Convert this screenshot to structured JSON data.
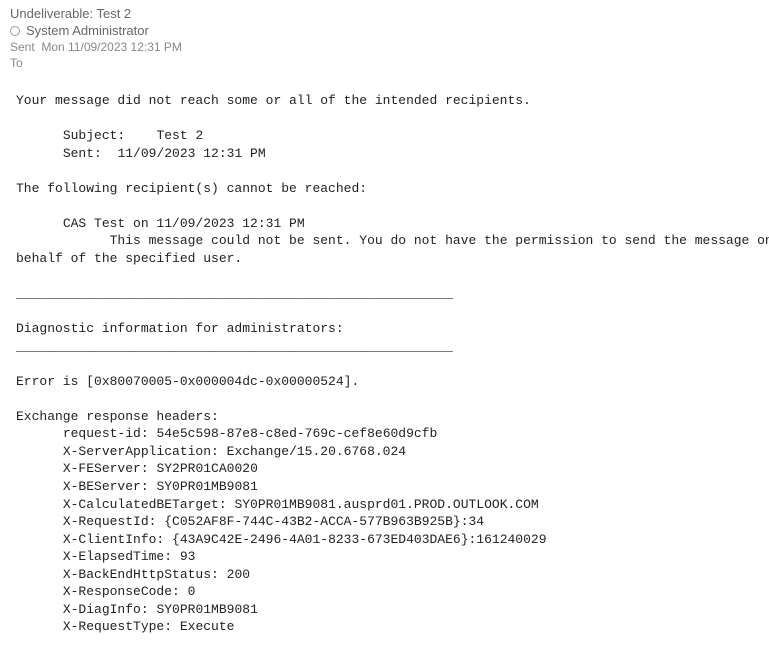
{
  "header": {
    "subject_line": "Undeliverable: Test 2",
    "from_name": "System Administrator",
    "sent_label": "Sent",
    "sent_value": "Mon 11/09/2023 12:31 PM",
    "to_label": "To"
  },
  "body": {
    "intro": "Your message did not reach some or all of the intended recipients.",
    "subject_label": "Subject:",
    "subject_value": "Test 2",
    "sent_label": "Sent:",
    "sent_value": "11/09/2023 12:31 PM",
    "recipient_heading": "The following recipient(s) cannot be reached:",
    "recipient_name": "CAS Test on 11/09/2023 12:31 PM",
    "recipient_error_l1": "This message could not be sent. You do not have the permission to send the message on",
    "recipient_error_l2": "behalf of the specified user.",
    "divider": "________________________________________________________",
    "diag_heading": "Diagnostic information for administrators:",
    "error_line": "Error is [0x80070005-0x000004dc-0x00000524].",
    "headers_heading": "Exchange response headers:",
    "headers": {
      "request_id_label": "request-id:",
      "request_id_value": "54e5c598-87e8-c8ed-769c-cef8e60d9cfb",
      "server_app_label": "X-ServerApplication:",
      "server_app_value": "Exchange/15.20.6768.024",
      "fe_label": "X-FEServer:",
      "fe_value": "SY2PR01CA0020",
      "be_label": "X-BEServer:",
      "be_value": "SY0PR01MB9081",
      "calcbe_label": "X-CalculatedBETarget:",
      "calcbe_value": "SY0PR01MB9081.ausprd01.PROD.OUTLOOK.COM",
      "reqid_label": "X-RequestId:",
      "reqid_value": "{C052AF8F-744C-43B2-ACCA-577B963B925B}:34",
      "client_label": "X-ClientInfo:",
      "client_value": "{43A9C42E-2496-4A01-8233-673ED403DAE6}:161240029",
      "elapsed_label": "X-ElapsedTime:",
      "elapsed_value": "93",
      "behttp_label": "X-BackEndHttpStatus:",
      "behttp_value": "200",
      "respcode_label": "X-ResponseCode:",
      "respcode_value": "0",
      "diag_label": "X-DiagInfo:",
      "diag_value": "SY0PR01MB9081",
      "reqtype_label": "X-RequestType:",
      "reqtype_value": "Execute"
    }
  }
}
